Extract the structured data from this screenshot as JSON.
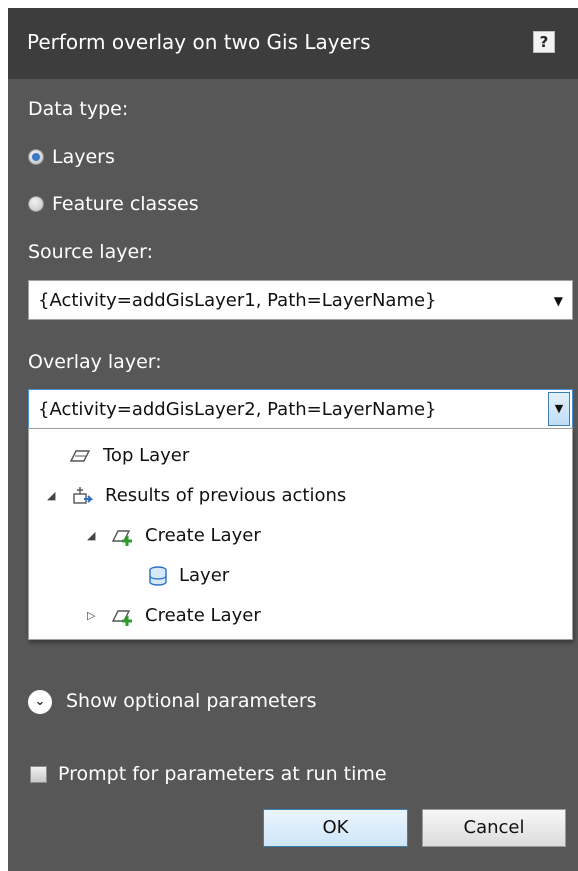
{
  "dialog": {
    "title": "Perform overlay on two Gis Layers",
    "help_label": "?"
  },
  "data_type": {
    "label": "Data type:",
    "options": [
      {
        "label": "Layers",
        "selected": true
      },
      {
        "label": "Feature classes",
        "selected": false
      }
    ]
  },
  "source_layer": {
    "label": "Source layer:",
    "value": "{Activity=addGisLayer1, Path=LayerName}"
  },
  "overlay_layer": {
    "label": "Overlay layer:",
    "value": "{Activity=addGisLayer2, Path=LayerName}",
    "tree": [
      {
        "label": "Top Layer",
        "icon": "layer-icon",
        "expander": ""
      },
      {
        "label": "Results of previous actions",
        "icon": "actions-icon",
        "expander": "expanded"
      },
      {
        "label": "Create Layer",
        "icon": "create-layer-icon",
        "expander": "expanded"
      },
      {
        "label": "Layer",
        "icon": "database-icon",
        "expander": ""
      },
      {
        "label": "Create Layer",
        "icon": "create-layer-icon",
        "expander": "collapsed"
      }
    ]
  },
  "optional_parameters": {
    "label": "Show optional parameters"
  },
  "prompt": {
    "label": "Prompt for parameters at run time",
    "checked": false
  },
  "buttons": {
    "ok": "OK",
    "cancel": "Cancel"
  },
  "colors": {
    "dialog_bg": "#575757",
    "titlebar_bg": "#3d3d3d",
    "accent": "#3a78c9",
    "green_plus": "#2e9a2e"
  }
}
